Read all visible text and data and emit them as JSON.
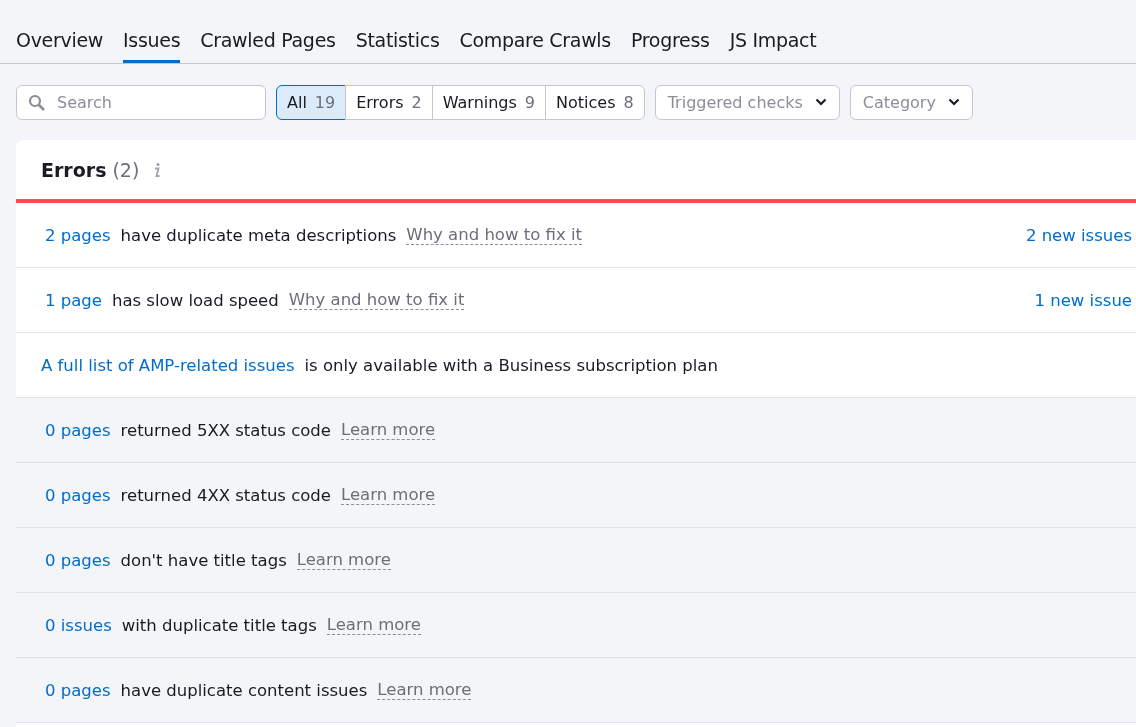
{
  "tabs": [
    {
      "label": "Overview",
      "selected": false
    },
    {
      "label": "Issues",
      "selected": true
    },
    {
      "label": "Crawled Pages",
      "selected": false
    },
    {
      "label": "Statistics",
      "selected": false
    },
    {
      "label": "Compare Crawls",
      "selected": false
    },
    {
      "label": "Progress",
      "selected": false
    },
    {
      "label": "JS Impact",
      "selected": false
    }
  ],
  "search": {
    "placeholder": "Search"
  },
  "filters": [
    {
      "label": "All",
      "count": "19",
      "selected": true
    },
    {
      "label": "Errors",
      "count": "2",
      "selected": false
    },
    {
      "label": "Warnings",
      "count": "9",
      "selected": false
    },
    {
      "label": "Notices",
      "count": "8",
      "selected": false
    }
  ],
  "dropdowns": [
    {
      "label": "Triggered checks"
    },
    {
      "label": "Category"
    }
  ],
  "section": {
    "title": "Errors",
    "count": "(2)"
  },
  "rows": [
    {
      "kind": "issue",
      "link": "2 pages",
      "text": "have duplicate meta descriptions",
      "help": "Why and how to fix it",
      "new_issues": "2 new issues"
    },
    {
      "kind": "issue",
      "link": "1 page",
      "text": "has slow load speed",
      "help": "Why and how to fix it",
      "new_issues": "1 new issue"
    },
    {
      "kind": "locked",
      "link": "A full list of AMP-related issues",
      "text": "is only available with a Business subscription plan"
    },
    {
      "kind": "inactive",
      "link": "0 pages",
      "text": "returned 5XX status code",
      "help": "Learn more"
    },
    {
      "kind": "inactive",
      "link": "0 pages",
      "text": "returned 4XX status code",
      "help": "Learn more"
    },
    {
      "kind": "inactive",
      "link": "0 pages",
      "text": "don't have title tags",
      "help": "Learn more"
    },
    {
      "kind": "inactive",
      "link": "0 issues",
      "text": "with duplicate title tags",
      "help": "Learn more"
    },
    {
      "kind": "inactive",
      "link": "0 pages",
      "text": "have duplicate content issues",
      "help": "Learn more"
    }
  ]
}
